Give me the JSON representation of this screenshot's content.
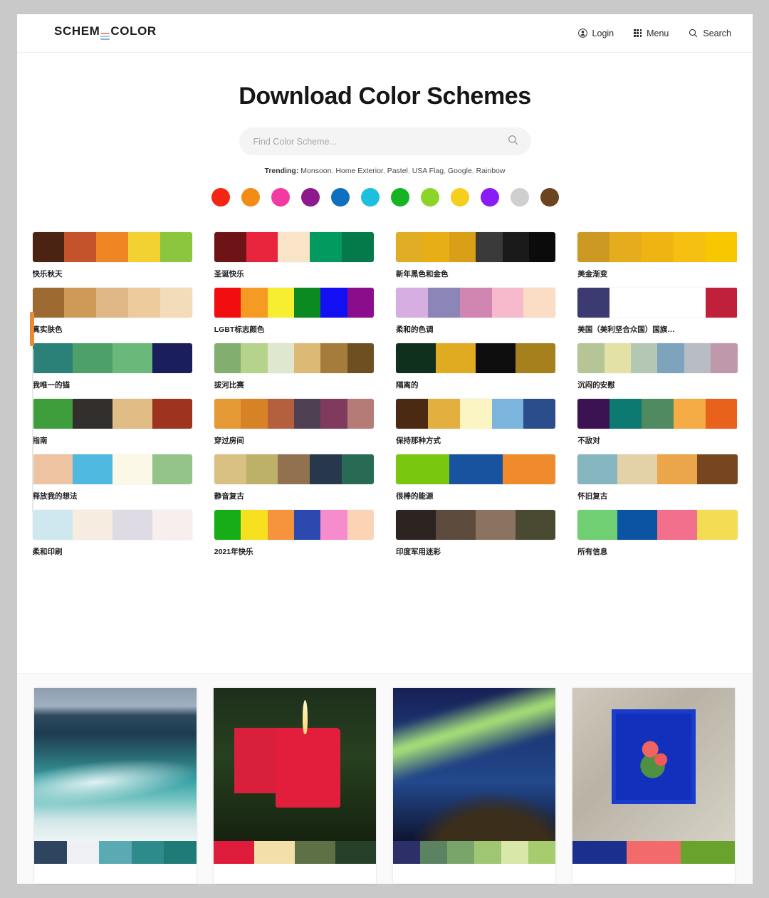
{
  "header": {
    "logo": {
      "text_before": "SCHEM",
      "text_after": "COLOR",
      "bar_colors": [
        "#f08a8a",
        "#8fd8d2",
        "#9aa7e0"
      ]
    },
    "nav": [
      {
        "label": "Login",
        "icon": "user-icon"
      },
      {
        "label": "Menu",
        "icon": "grid-menu-icon"
      },
      {
        "label": "Search",
        "icon": "search-icon"
      }
    ]
  },
  "hero": {
    "title": "Download Color Schemes",
    "search": {
      "value": "",
      "placeholder": "Find Color Scheme...",
      "icon": "search-icon"
    },
    "trending": {
      "label": "Trending:",
      "items": [
        "Monsoon",
        "Home Exterior",
        "Pastel",
        "USA Flag",
        "Google",
        "Rainbow"
      ]
    },
    "color_dots": [
      {
        "name": "red",
        "hex": "#f22613"
      },
      {
        "name": "orange",
        "hex": "#f28c17"
      },
      {
        "name": "pink",
        "hex": "#f23aa0"
      },
      {
        "name": "purple",
        "hex": "#8c1a8c"
      },
      {
        "name": "blue",
        "hex": "#0f70c0"
      },
      {
        "name": "cyan",
        "hex": "#1cc0de"
      },
      {
        "name": "green",
        "hex": "#16b422"
      },
      {
        "name": "lime",
        "hex": "#8cd429"
      },
      {
        "name": "yellow",
        "hex": "#f5ce1e"
      },
      {
        "name": "violet",
        "hex": "#8a1df5"
      },
      {
        "name": "silver",
        "hex": "#cfcfcf"
      },
      {
        "name": "brown",
        "hex": "#6b4420"
      }
    ]
  },
  "palettes": [
    {
      "name": "快乐秋天",
      "colors": [
        "#4a2313",
        "#c4522a",
        "#ef8523",
        "#f2d232",
        "#8cc63f"
      ]
    },
    {
      "name": "圣诞快乐",
      "colors": [
        "#6e1416",
        "#e8253c",
        "#fae4c8",
        "#029a5e",
        "#047a4a"
      ]
    },
    {
      "name": "新年黑色和金色",
      "colors": [
        "#e0ad24",
        "#e8ae15",
        "#d9a017",
        "#3a3a3a",
        "#1a1a1a",
        "#0b0b0b"
      ]
    },
    {
      "name": "美金渐变",
      "colors": [
        "#cc9a22",
        "#e5ac1e",
        "#f0b412",
        "#f6c012",
        "#f7c800"
      ]
    },
    {
      "name": "真实肤色",
      "colors": [
        "#9d6b32",
        "#cf9a58",
        "#e0b887",
        "#edcb9c",
        "#f2dcb9"
      ]
    },
    {
      "name": "LGBT标志颜色",
      "colors": [
        "#f20d11",
        "#f59a22",
        "#f7ee31",
        "#0b8a22",
        "#1210f2",
        "#8c0d8c"
      ]
    },
    {
      "name": "柔和的色调",
      "colors": [
        "#d6aee2",
        "#8c85b8",
        "#d086b0",
        "#f7bacd",
        "#fbdcc5"
      ]
    },
    {
      "name": "美国（美利坚合众国）国旗…",
      "colors": [
        "#3b3b72",
        "#ffffff",
        "#ffffff",
        "#c1htm",
        "#c1203a"
      ]
    },
    {
      "name": "我唯一的锚",
      "colors": [
        "#2b8077",
        "#4ea069",
        "#6ab87a",
        "#1a1f5c"
      ]
    },
    {
      "name": "拔河比赛",
      "colors": [
        "#82ae70",
        "#b6d38c",
        "#dfe8ce",
        "#ddb976",
        "#a67c3c",
        "#6e4f22"
      ]
    },
    {
      "name": "隔离的",
      "colors": [
        "#10301e",
        "#e0ab20",
        "#0e0e0e",
        "#a5801c"
      ]
    },
    {
      "name": "沉闷的安慰",
      "colors": [
        "#b6c596",
        "#e3e1a5",
        "#b4c6b4",
        "#7ea3bd",
        "#b8bcc4",
        "#bf99ab"
      ]
    },
    {
      "name": "指南",
      "colors": [
        "#3f9e3c",
        "#332f2d",
        "#e0bd84",
        "#9e3320"
      ]
    },
    {
      "name": "穿过房间",
      "colors": [
        "#e59a35",
        "#d88227",
        "#b4603f",
        "#4f4054",
        "#803a5e",
        "#b57b77"
      ]
    },
    {
      "name": "保持那种方式",
      "colors": [
        "#4a2a12",
        "#e3b040",
        "#faf5c2",
        "#7bb5de",
        "#2a4e8c"
      ]
    },
    {
      "name": "不敌对",
      "colors": [
        "#3b1252",
        "#0d7a72",
        "#4f8a61",
        "#f5ac45",
        "#e8621b"
      ]
    },
    {
      "name": "释放我的想法",
      "colors": [
        "#eec3a1",
        "#4fb9e0",
        "#fbf8e8",
        "#95c48a"
      ]
    },
    {
      "name": "静音复古",
      "colors": [
        "#d9c183",
        "#bdb069",
        "#91714f",
        "#27384c",
        "#276b55"
      ]
    },
    {
      "name": "很棒的能源",
      "colors": [
        "#7ac70f",
        "#17539e",
        "#ef8b2c"
      ]
    },
    {
      "name": "怀旧复古",
      "colors": [
        "#85b6bf",
        "#e3d2a8",
        "#eba54a",
        "#77451f"
      ]
    },
    {
      "name": "柔和印刷",
      "colors": [
        "#cfe8ef",
        "#f7ece0",
        "#dfdbe4",
        "#f7eeee"
      ]
    },
    {
      "name": "2021年快乐",
      "colors": [
        "#16ad17",
        "#f7e020",
        "#f5943c",
        "#2c49b0",
        "#f78ccd",
        "#fbd4b6"
      ]
    },
    {
      "name": "印度军用迷彩",
      "colors": [
        "#2b2420",
        "#5c4a3c",
        "#8a7360",
        "#4a4a33"
      ]
    },
    {
      "name": "所有信息",
      "colors": [
        "#6fcf72",
        "#0b54a3",
        "#f2708b",
        "#f5dc55"
      ]
    }
  ],
  "photo_cards": [
    {
      "name": "ocean-wave-photo",
      "art": "ph-wave",
      "colors": [
        "#2e4560",
        "#eef0f3",
        "#59aab2",
        "#2e8b8c",
        "#1f7b75"
      ]
    },
    {
      "name": "red-candle-photo",
      "art": "ph-candle",
      "colors": [
        "#e01c3c",
        "#f2e0a8",
        "#5e7046",
        "#26402a"
      ]
    },
    {
      "name": "aurora-borealis-photo",
      "art": "ph-aurora",
      "colors": [
        "#2d2f68",
        "#5b8261",
        "#79a46a",
        "#9fc672",
        "#d9e8a8",
        "#a6cc6e"
      ]
    },
    {
      "name": "blue-window-flowers-photo",
      "art": "ph-window",
      "colors": [
        "#1b2f8f",
        "#f26a6a",
        "#6aa32b"
      ]
    }
  ]
}
